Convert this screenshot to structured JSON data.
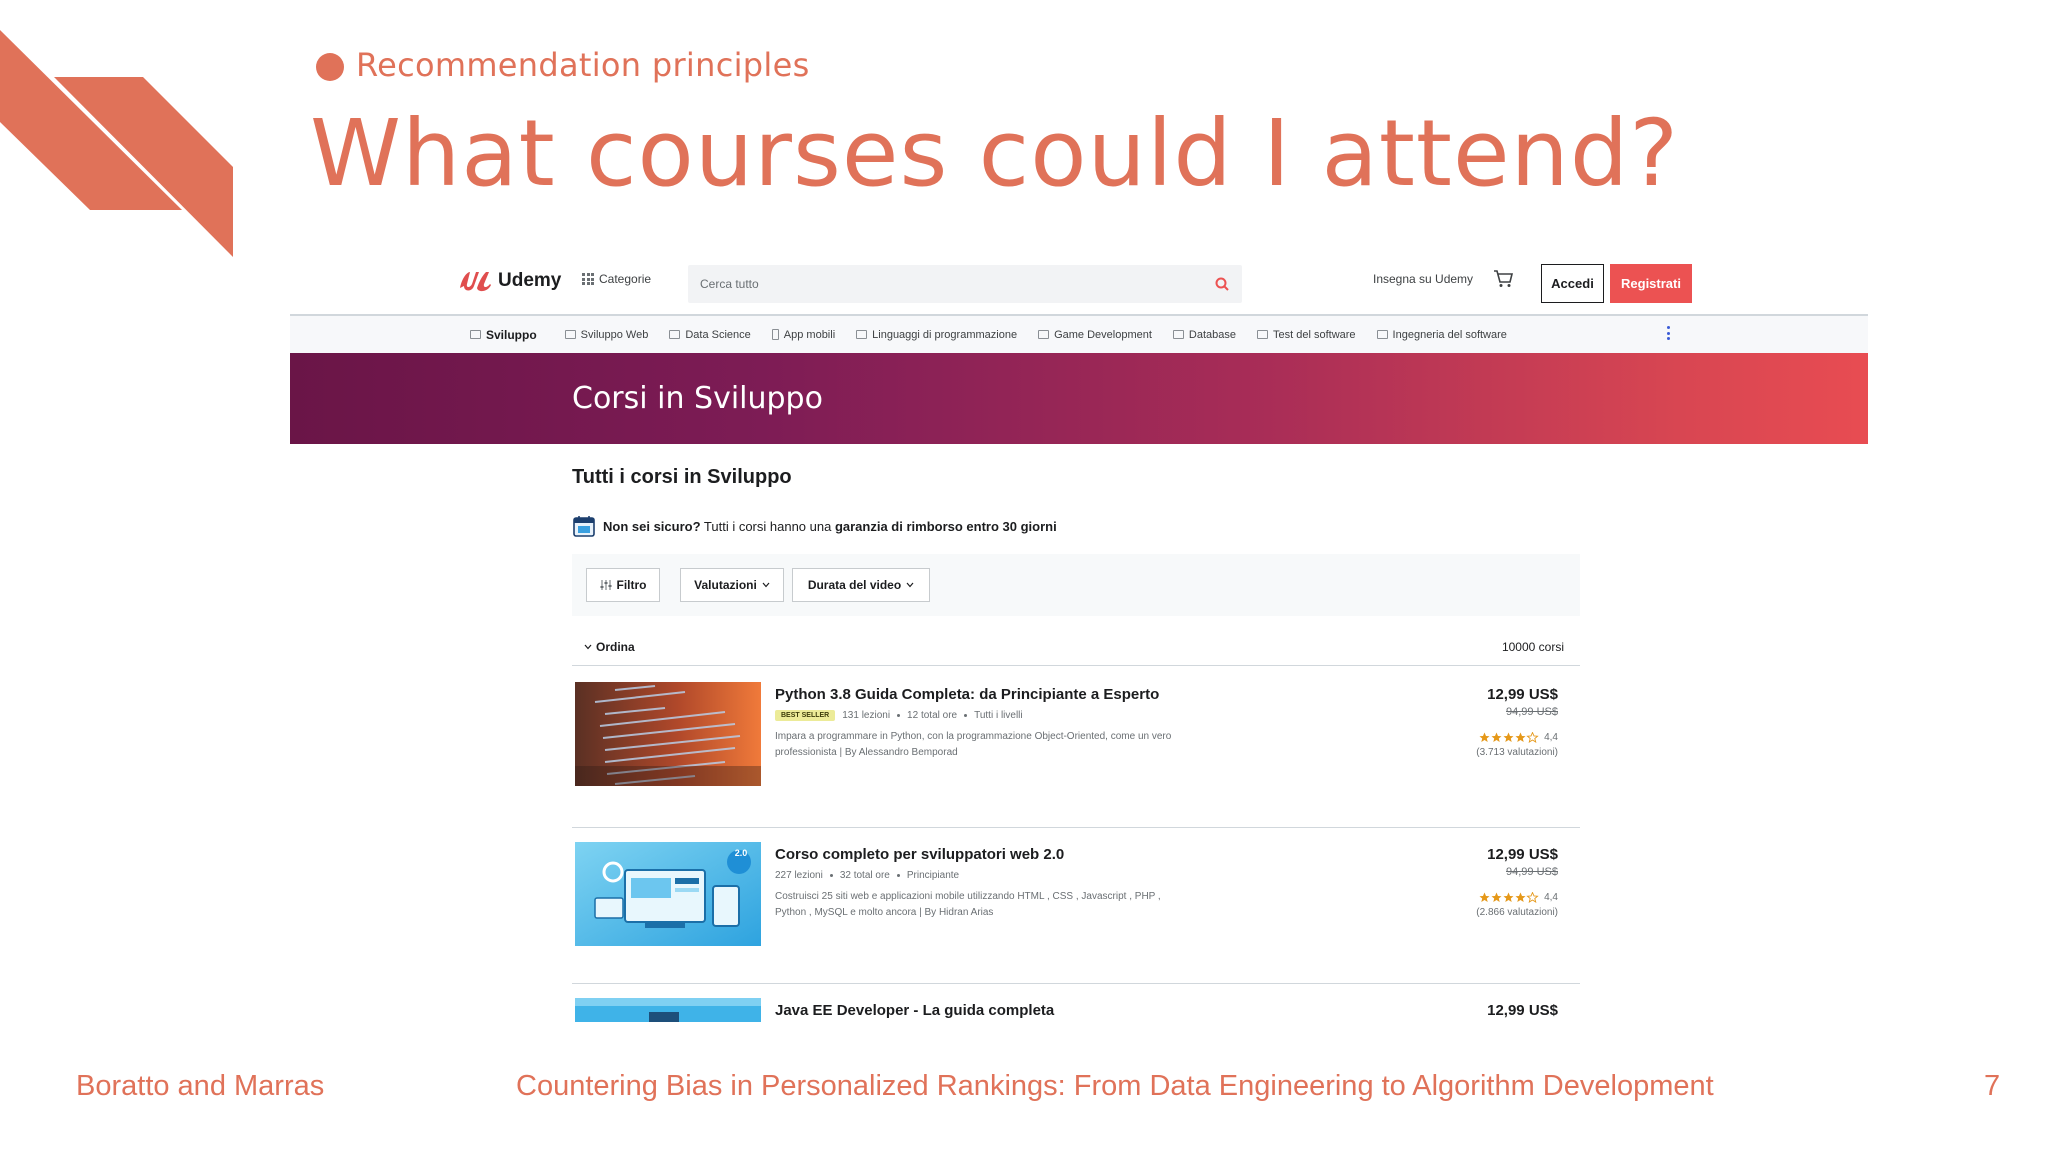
{
  "slide": {
    "section_label": "Recommendation principles",
    "title": "What courses could I attend?",
    "footer_authors": "Boratto and Marras",
    "footer_talk": "Countering Bias in Personalized Rankings: From Data Engineering to Algorithm Development",
    "page_number": "7",
    "accent_color": "#e07259"
  },
  "udemy": {
    "logo_text": "Udemy",
    "categories_label": "Categorie",
    "search_placeholder": "Cerca tutto",
    "teach_label": "Insegna su Udemy",
    "login_label": "Accedi",
    "signup_label": "Registrati",
    "brand_color": "#ec5252",
    "subnav": [
      "Sviluppo",
      "Sviluppo Web",
      "Data Science",
      "App mobili",
      "Linguaggi di programmazione",
      "Game Development",
      "Database",
      "Test del software",
      "Ingegneria del software"
    ],
    "banner_title": "Corsi in Sviluppo",
    "all_courses_title": "Tutti i corsi in Sviluppo",
    "guarantee": {
      "bold_lead": "Non sei sicuro?",
      "middle": " Tutti i corsi hanno una ",
      "bold_tail": "garanzia di rimborso entro 30 giorni"
    },
    "filters": {
      "filter_label": "Filtro",
      "ratings_label": "Valutazioni",
      "duration_label": "Durata del video"
    },
    "sort_label": "Ordina",
    "course_count": "10000 corsi",
    "courses": [
      {
        "title": "Python 3.8 Guida Completa: da Principiante a Esperto",
        "badge": "BEST SELLER",
        "lectures": "131 lezioni",
        "hours": "12 total ore",
        "level": "Tutti i livelli",
        "description": "Impara a programmare in Python, con la programmazione Object-Oriented, come un vero professionista | By Alessandro Bemporad",
        "price": "12,99 US$",
        "old_price": "94,99 US$",
        "rating": "4,4",
        "reviews": "(3.713 valutazioni)"
      },
      {
        "title": "Corso completo per sviluppatori web 2.0",
        "badge": "",
        "lectures": "227 lezioni",
        "hours": "32 total ore",
        "level": "Principiante",
        "description": "Costruisci 25 siti web e applicazioni mobile utilizzando HTML , CSS , Javascript , PHP , Python , MySQL e molto ancora | By Hidran Arias",
        "price": "12,99 US$",
        "old_price": "94,99 US$",
        "rating": "4,4",
        "reviews": "(2.866 valutazioni)",
        "thumb_badge": "2.0"
      },
      {
        "title": "Java EE Developer - La guida completa",
        "price": "12,99 US$"
      }
    ]
  }
}
